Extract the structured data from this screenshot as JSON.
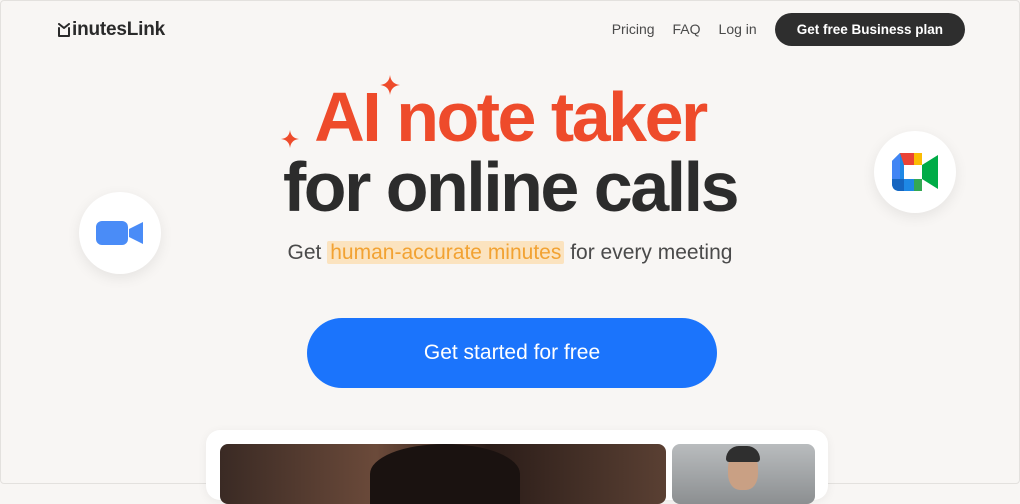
{
  "brand": {
    "name": "inutesLink",
    "logo_icon": "minuteslink-m-logo"
  },
  "nav": {
    "links": [
      "Pricing",
      "FAQ",
      "Log in"
    ],
    "cta": "Get free Business plan"
  },
  "hero": {
    "headline_line1": "AI note taker",
    "headline_line2": "for online calls",
    "subtitle_pre": "Get",
    "subtitle_highlight": "human-accurate minutes",
    "subtitle_post": "for every meeting",
    "cta": "Get started for free"
  },
  "badges": {
    "left": "zoom-icon",
    "right": "google-meet-icon"
  },
  "colors": {
    "accent_red": "#ee4b2b",
    "cta_blue": "#1b74fc",
    "highlight_text": "#f2a232",
    "highlight_bg": "#fbe3bf",
    "dark_button": "#2e2e2e",
    "background": "#f8f6f4"
  }
}
